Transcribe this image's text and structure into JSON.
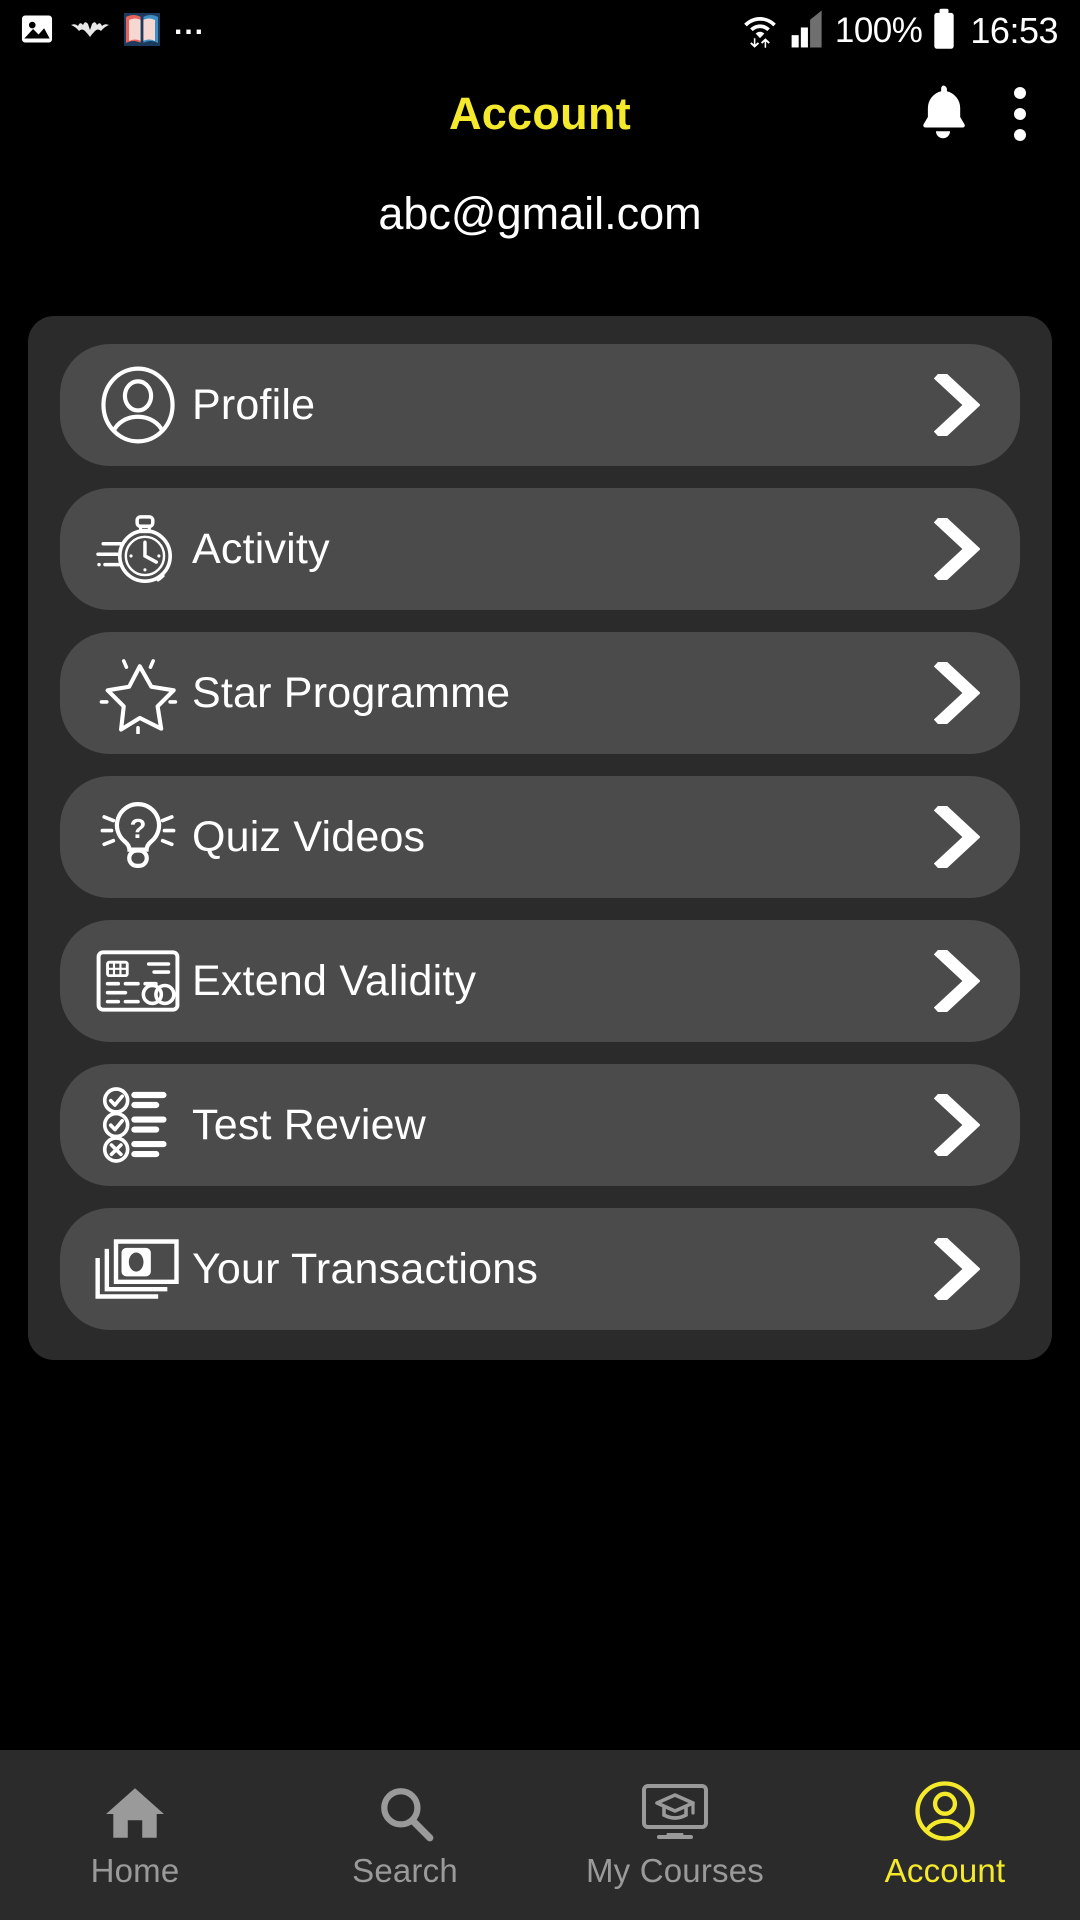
{
  "theme": {
    "background": "#000000",
    "card_background": "#2b2b2b",
    "row_background": "#4b4b4b",
    "accent": "#f5e92b",
    "text_primary": "#ffffff",
    "text_muted": "#9a9a9a"
  },
  "statusbar": {
    "icons": [
      "gallery-image-icon",
      "bat-icon",
      "open-book-icon"
    ],
    "overflow": "...",
    "wifi": "wifi-icon",
    "signal": "cellular-signal-icon",
    "battery_percent": "100%",
    "battery": "battery-full-icon",
    "time": "16:53"
  },
  "header": {
    "title": "Account",
    "notifications_icon": "bell-icon",
    "overflow_icon": "kebab-menu-icon"
  },
  "account": {
    "email": "abc@gmail.com"
  },
  "menu": {
    "items": [
      {
        "label": "Profile",
        "icon": "user-circle-icon",
        "chevron": "chevron-right-icon"
      },
      {
        "label": "Activity",
        "icon": "stopwatch-icon",
        "chevron": "chevron-right-icon"
      },
      {
        "label": "Star Programme",
        "icon": "star-sparkle-icon",
        "chevron": "chevron-right-icon"
      },
      {
        "label": "Quiz Videos",
        "icon": "lightbulb-question-icon",
        "chevron": "chevron-right-icon"
      },
      {
        "label": "Extend Validity",
        "icon": "id-card-icon",
        "chevron": "chevron-right-icon"
      },
      {
        "label": "Test Review",
        "icon": "checklist-icon",
        "chevron": "chevron-right-icon"
      },
      {
        "label": "Your Transactions",
        "icon": "banknotes-icon",
        "chevron": "chevron-right-icon"
      }
    ]
  },
  "bottomnav": {
    "items": [
      {
        "label": "Home",
        "icon": "home-icon",
        "active": false
      },
      {
        "label": "Search",
        "icon": "search-icon",
        "active": false
      },
      {
        "label": "My Courses",
        "icon": "monitor-graduation-icon",
        "active": false
      },
      {
        "label": "Account",
        "icon": "user-circle-icon",
        "active": true
      }
    ]
  }
}
